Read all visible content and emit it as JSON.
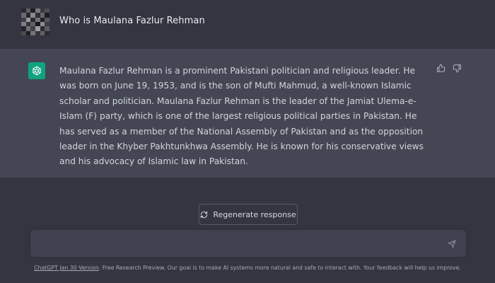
{
  "conversation": {
    "user_message": "Who is Maulana Fazlur Rehman",
    "assistant_message": "Maulana Fazlur Rehman is a prominent Pakistani politician and religious leader. He was born on June 19, 1953, and is the son of Mufti Mahmud, a well-known Islamic scholar and politician. Maulana Fazlur Rehman is the leader of the Jamiat Ulema-e-Islam (F) party, which is one of the largest religious political parties in Pakistan. He has served as a member of the National Assembly of Pakistan and as the opposition leader in the Khyber Pakhtunkhwa Assembly. He is known for his conservative views and his advocacy of Islamic law in Pakistan."
  },
  "controls": {
    "regenerate_label": "Regenerate response",
    "input_value": ""
  },
  "footer": {
    "version_link": "ChatGPT Jan 30 Version",
    "disclaimer": ". Free Research Preview. Our goal is to make AI systems more natural and safe to interact with. Your feedback will help us improve."
  },
  "icons": {
    "assistant_avatar": "openai-logo-icon",
    "thumbs_up": "thumbs-up-icon",
    "thumbs_down": "thumbs-down-icon",
    "regenerate": "refresh-icon",
    "send": "send-icon"
  },
  "colors": {
    "background": "#343541",
    "assistant_background": "#444654",
    "input_background": "#40414f",
    "brand_green": "#10a37f"
  }
}
